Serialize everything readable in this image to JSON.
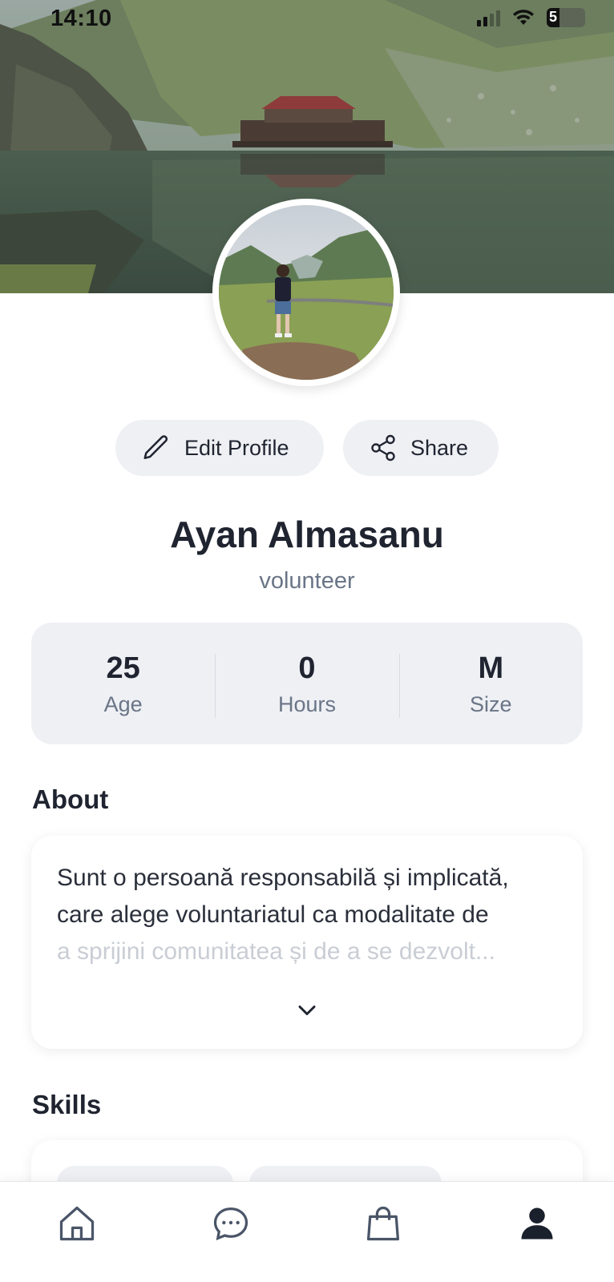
{
  "status_bar": {
    "time": "14:10",
    "battery_level": "5",
    "icons": [
      "cellular-signal-icon",
      "wifi-icon",
      "battery-icon"
    ]
  },
  "profile": {
    "name": "Ayan Almasanu",
    "role": "volunteer",
    "actions": {
      "edit_label": "Edit Profile",
      "share_label": "Share"
    }
  },
  "stats": [
    {
      "value": "25",
      "label": "Age"
    },
    {
      "value": "0",
      "label": "Hours"
    },
    {
      "value": "M",
      "label": "Size"
    }
  ],
  "about": {
    "title": "About",
    "lines": [
      "Sunt o persoană responsabilă și implicată,",
      "care alege voluntariatul ca modalitate de",
      "a sprijini comunitatea și de a se dezvolt..."
    ],
    "expand_icon": "chevron-down-icon"
  },
  "skills": {
    "title": "Skills"
  },
  "bottom_nav": {
    "items": [
      {
        "icon": "home-icon",
        "active": false
      },
      {
        "icon": "chat-icon",
        "active": false
      },
      {
        "icon": "shopping-bag-icon",
        "active": false
      },
      {
        "icon": "user-icon",
        "active": true
      }
    ]
  },
  "colors": {
    "text_primary": "#1f2430",
    "text_secondary": "#6a7587",
    "surface": "#eef0f4",
    "nav_icon": "#4a5568",
    "nav_icon_active": "#1a202c"
  }
}
